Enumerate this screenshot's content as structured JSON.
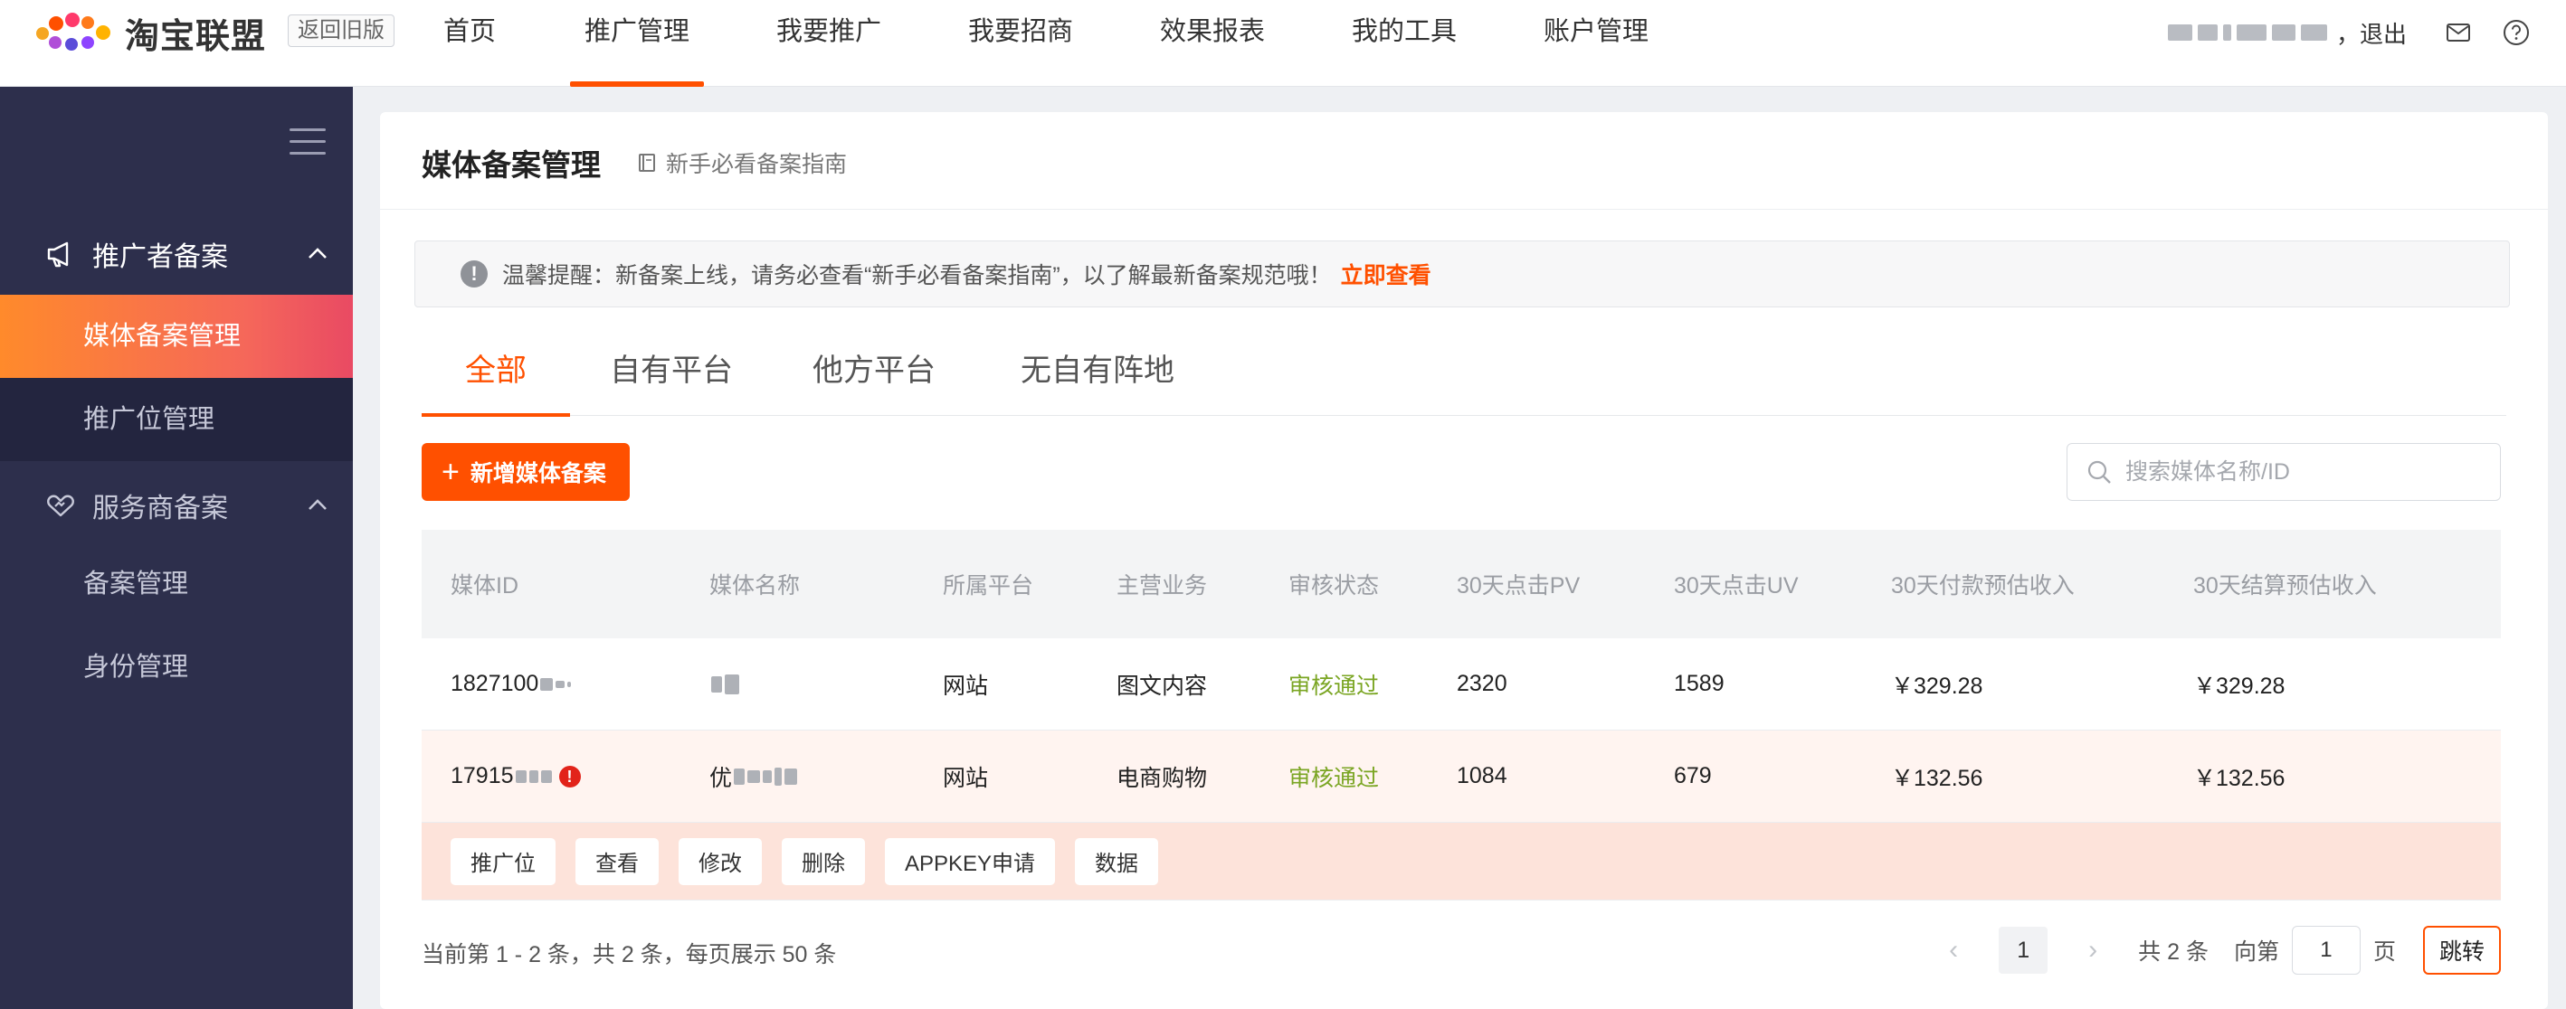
{
  "brand": {
    "name": "淘宝联盟",
    "back_old": "返回旧版"
  },
  "nav": {
    "items": [
      "首页",
      "推广管理",
      "我要推广",
      "我要招商",
      "效果报表",
      "我的工具",
      "账户管理"
    ],
    "active_index": 1
  },
  "user": {
    "logout": "，退出",
    "icons": [
      "mail-icon",
      "help-icon"
    ]
  },
  "sidebar": {
    "groups": [
      {
        "label": "推广者备案",
        "icon": "megaphone-icon",
        "expanded": true,
        "items": [
          "媒体备案管理",
          "推广位管理"
        ]
      },
      {
        "label": "服务商备案",
        "icon": "handshake-icon",
        "expanded": true,
        "items": [
          "备案管理",
          "身份管理"
        ]
      }
    ],
    "active_item": "媒体备案管理"
  },
  "page": {
    "title": "媒体备案管理",
    "guide_link": "新手必看备案指南",
    "notice": {
      "text": "温馨提醒：新备案上线，请务必查看“新手必看备案指南”，以了解最新备案规范哦！",
      "link": "立即查看"
    },
    "tabs": [
      "全部",
      "自有平台",
      "他方平台",
      "无自有阵地"
    ],
    "active_tab": 0,
    "add_button": "新增媒体备案",
    "search_placeholder": "搜索媒体名称/ID"
  },
  "table": {
    "headers": [
      "媒体ID",
      "媒体名称",
      "所属平台",
      "主营业务",
      "审核状态",
      "30天点击PV",
      "30天点击UV",
      "30天付款预估收入",
      "30天结算预估收入"
    ],
    "rows": [
      {
        "id": "1827100",
        "name": "",
        "platform": "网站",
        "business": "图文内容",
        "status": "审核通过",
        "pv": "2320",
        "uv": "1589",
        "pay": "￥329.28",
        "settle": "￥329.28"
      },
      {
        "id": "17915",
        "name": "优",
        "platform": "网站",
        "business": "电商购物",
        "status": "审核通过",
        "pv": "1084",
        "uv": "679",
        "pay": "￥132.56",
        "settle": "￥132.56"
      }
    ],
    "actions": [
      "推广位",
      "查看",
      "修改",
      "删除",
      "APPKEY申请",
      "数据"
    ]
  },
  "footer": {
    "info": "当前第 1 - 2 条，共 2 条，每页展示 50 条",
    "current_page": "1",
    "total": "共 2 条",
    "goto_prefix": "向第",
    "goto_value": "1",
    "goto_suffix": "页",
    "jump": "跳转"
  },
  "colors": {
    "accent": "#ff5000",
    "sidebar_bg": "#2d2f4c",
    "approved": "#7aa522"
  }
}
